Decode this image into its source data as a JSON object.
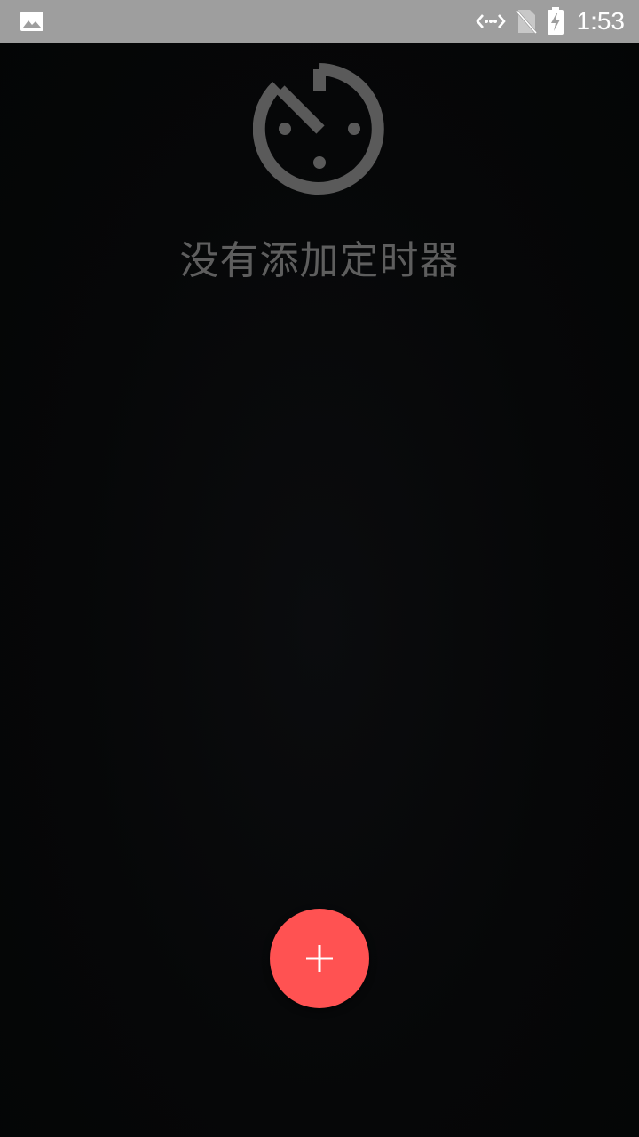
{
  "status_bar": {
    "time": "1:53",
    "icons": [
      "image-notification-icon",
      "data-transfer-icon",
      "no-sim-icon",
      "battery-charging-icon"
    ]
  },
  "empty_state": {
    "icon": "timer-icon",
    "message": "没有添加定时器"
  },
  "fab": {
    "icon": "plus-icon",
    "color": "#ff5252"
  },
  "colors": {
    "background": "#050607",
    "status_bar": "#9e9e9e",
    "muted_text": "#5e5e5e",
    "accent": "#ff5252"
  }
}
